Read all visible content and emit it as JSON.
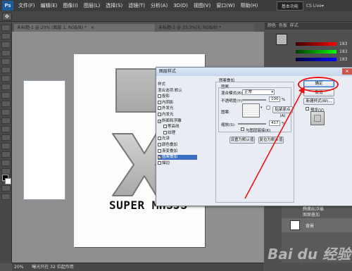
{
  "app": {
    "logo_text": "Ps"
  },
  "menubar": {
    "items": [
      "文件(F)",
      "编辑(E)",
      "图像(I)",
      "图层(L)",
      "选择(S)",
      "滤镜(T)",
      "分析(A)",
      "3D(D)",
      "视图(V)",
      "窗口(W)",
      "帮助(H)"
    ],
    "workspace": "基本功能",
    "cs_live": "CS Live▾"
  },
  "document": {
    "tab_label": "未标题-1 @ 20% (图层 1, RGB/8) *",
    "close": "×",
    "second_tab": "未标题-2 @ 33.3%(X, RGB/8) *",
    "canvas_text": "SUPER MHSJS",
    "status": [
      "20%",
      "曝光只在 32 位起作用"
    ]
  },
  "color_panel": {
    "tabs": [
      "颜色",
      "色板",
      "样式"
    ],
    "values": [
      "183",
      "183",
      "183"
    ]
  },
  "layers_panel": {
    "rows": [
      "效果",
      "斜面和浮雕",
      "图案叠加"
    ],
    "bg_label": "背景"
  },
  "dialog": {
    "title": "图层样式",
    "close": "✕",
    "style_list": [
      {
        "label": "样式",
        "checked": null,
        "selected": false,
        "header": true
      },
      {
        "label": "混合选项:默认",
        "checked": null,
        "selected": false,
        "header": true
      },
      {
        "label": "投影",
        "checked": false,
        "selected": false,
        "header": false
      },
      {
        "label": "内阴影",
        "checked": false,
        "selected": false,
        "header": false
      },
      {
        "label": "外发光",
        "checked": false,
        "selected": false,
        "header": false
      },
      {
        "label": "内发光",
        "checked": false,
        "selected": false,
        "header": false
      },
      {
        "label": "斜面和浮雕",
        "checked": true,
        "selected": false,
        "header": false
      },
      {
        "label": "等高线",
        "checked": false,
        "selected": false,
        "header": false,
        "indent": true
      },
      {
        "label": "纹理",
        "checked": false,
        "selected": false,
        "header": false,
        "indent": true
      },
      {
        "label": "光泽",
        "checked": false,
        "selected": false,
        "header": false
      },
      {
        "label": "颜色叠加",
        "checked": false,
        "selected": false,
        "header": false
      },
      {
        "label": "渐变叠加",
        "checked": false,
        "selected": false,
        "header": false
      },
      {
        "label": "图案叠加",
        "checked": true,
        "selected": true,
        "header": false
      },
      {
        "label": "描边",
        "checked": false,
        "selected": false,
        "header": false
      }
    ],
    "section_title": "图案叠加",
    "subsection": "图案",
    "blend_mode_label": "混合模式(B):",
    "blend_mode_value": "正常",
    "opacity_label": "不透明度(Y):",
    "opacity_value": "100",
    "percent": "%",
    "pattern_label": "图案:",
    "snap_origin_btn": "贴紧原点(A)",
    "scale_label": "缩放(S):",
    "scale_value": "417",
    "link_layer_label": "与图层链接(K)",
    "make_default_btn": "设置为默认值",
    "reset_default_btn": "复位为默认值",
    "ok_btn": "确定",
    "cancel_btn": "取消",
    "new_style_btn": "新建样式(W)...",
    "preview_label": "预览(V)"
  },
  "watermark": "Bai du 经验"
}
